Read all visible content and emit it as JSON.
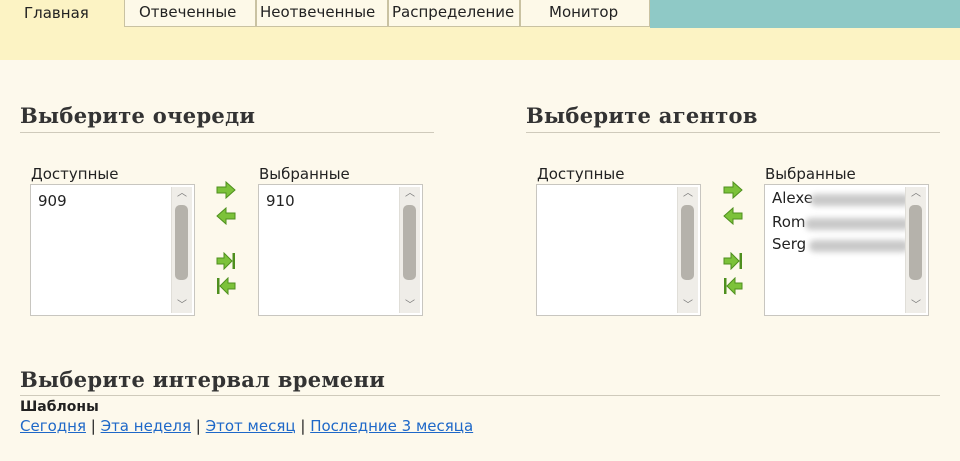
{
  "tabs": [
    "Главная",
    "Отвеченные",
    "Неотвеченные",
    "Распределение",
    "Монитор"
  ],
  "queues": {
    "title": "Выберите очереди",
    "available_label": "Доступные",
    "selected_label": "Выбранные",
    "available": [
      "909"
    ],
    "selected": [
      "910"
    ]
  },
  "agents": {
    "title": "Выберите агентов",
    "available_label": "Доступные",
    "selected_label": "Выбранные",
    "available": [],
    "selected": [
      "Alexe",
      "Rom",
      "Serg"
    ]
  },
  "interval": {
    "title": "Выберите интервал времени",
    "templates_label": "Шаблоны",
    "links": [
      "Сегодня",
      "Эта неделя",
      "Этот месяц",
      "Последние 3 месяца"
    ],
    "separator": "|"
  },
  "colors": {
    "arrow_green": "#6fbf2c",
    "link": "#1e68c8",
    "teal": "#8fc9c6",
    "tab_bg": "#fcf3c4"
  },
  "icons": {
    "move_right": "arrow-right-icon",
    "move_left": "arrow-left-icon",
    "move_all_right": "arrow-right-all-icon",
    "move_all_left": "arrow-left-all-icon"
  }
}
